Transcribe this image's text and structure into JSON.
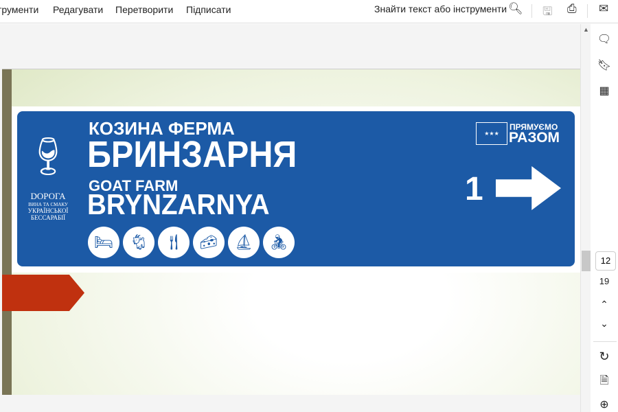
{
  "toolbar": {
    "menu": [
      "трументи",
      "Редагувати",
      "Перетворити",
      "Підписати"
    ],
    "search_label": "Знайти текст або інструменти"
  },
  "sign": {
    "line1": "КОЗИНА ФЕРМА",
    "line2": "БРИНЗАРНЯ",
    "line3": "GOAT FARM",
    "line4": "BRYNZARNYA",
    "logo": [
      "DOРОГА",
      "ВИНА ТА СМАКУ",
      "УКРАЇНСЬКОЇ",
      "БЕССАРАБІЇ"
    ],
    "eu_badge": [
      "ПРЯМУЄМО",
      "РАЗОМ"
    ],
    "distance": "1"
  },
  "pagination": {
    "current_page": "12",
    "total_pages": "19"
  },
  "colors": {
    "sign_blue": "#1c5aa6",
    "arrow_red": "#c0310f"
  }
}
